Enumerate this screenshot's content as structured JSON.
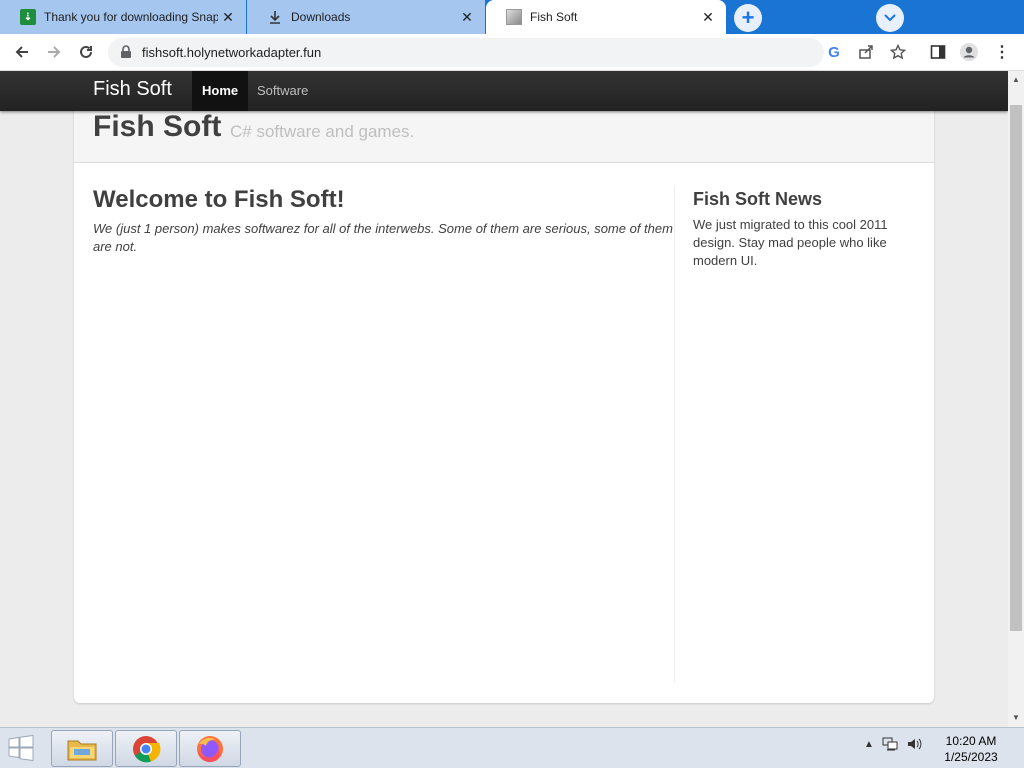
{
  "tabs": [
    {
      "title": "Thank you for downloading Snap",
      "favicon": "download-sheet-icon"
    },
    {
      "title": "Downloads",
      "favicon": "download-arrow-icon"
    },
    {
      "title": "Fish Soft",
      "favicon": "page-image-icon"
    }
  ],
  "address_bar": {
    "url": "fishsoft.holynetworkadapter.fun"
  },
  "site": {
    "brand": "Fish Soft",
    "nav": [
      {
        "label": "Home",
        "active": true
      },
      {
        "label": "Software",
        "active": false
      }
    ],
    "hero_title": "Fish Soft",
    "hero_tagline": "C# software and games.",
    "welcome_heading": "Welcome to Fish Soft!",
    "welcome_text": "We (just 1 person) makes softwarez for all of the interwebs. Some of them are serious, some of them are not.",
    "news_heading": "Fish Soft News",
    "news_text": "We just migrated to this cool 2011 design. Stay mad people who like modern UI."
  },
  "taskbar": {
    "apps": [
      "file-explorer-icon",
      "chrome-icon",
      "firefox-icon"
    ],
    "time": "10:20 AM",
    "date": "1/25/2023"
  }
}
